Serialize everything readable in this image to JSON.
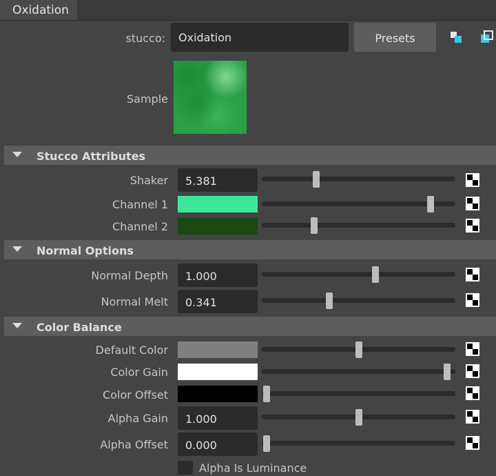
{
  "tab": {
    "label": "Oxidation"
  },
  "header": {
    "node_type_label": "stucco:",
    "node_name": "Oxidation",
    "presets_label": "Presets",
    "sample_label": "Sample"
  },
  "sections": {
    "stucco_attributes": "Stucco Attributes",
    "normal_options": "Normal Options",
    "color_balance": "Color Balance"
  },
  "attributes": {
    "shaker": {
      "label": "Shaker",
      "value": "5.381",
      "slider": 0.27
    },
    "channel1": {
      "label": "Channel 1",
      "color": "#3ee89b",
      "slider": 0.89
    },
    "channel2": {
      "label": "Channel 2",
      "color": "#1a4a12",
      "slider": 0.26
    },
    "normal_depth": {
      "label": "Normal Depth",
      "value": "1.000",
      "slider": 0.59
    },
    "normal_melt": {
      "label": "Normal Melt",
      "value": "0.341",
      "slider": 0.34
    },
    "default_color": {
      "label": "Default Color",
      "color": "#7f7f7f",
      "slider": 0.5
    },
    "color_gain": {
      "label": "Color Gain",
      "color": "#ffffff",
      "slider": 0.98
    },
    "color_offset": {
      "label": "Color Offset",
      "color": "#000000",
      "slider": 0.0
    },
    "alpha_gain": {
      "label": "Alpha Gain",
      "value": "1.000",
      "slider": 0.5
    },
    "alpha_offset": {
      "label": "Alpha Offset",
      "value": "0.000",
      "slider": 0.0
    },
    "alpha_is_luminance": {
      "label": "Alpha Is Luminance",
      "checked": false
    }
  },
  "colors": {
    "accent": "#3ec7e0",
    "panel": "#444444",
    "section": "#5d5d5d",
    "field": "#2b2b2b"
  },
  "icons": {
    "graph": "copy-tab-icon",
    "link": "map-button-icon"
  }
}
